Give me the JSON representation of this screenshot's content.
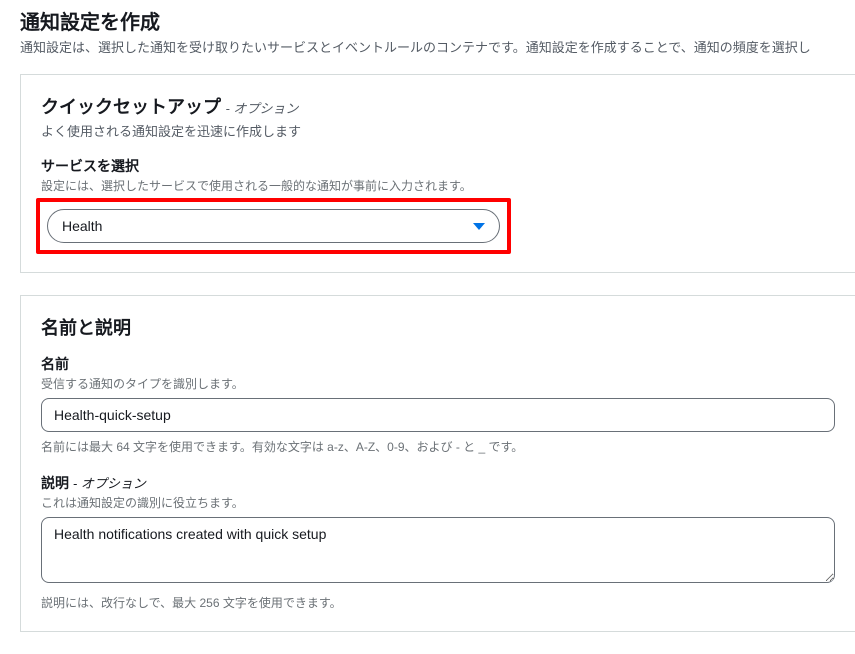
{
  "page": {
    "title": "通知設定を作成",
    "description": "通知設定は、選択した通知を受け取りたいサービスとイベントルールのコンテナです。通知設定を作成することで、通知の頻度を選択し"
  },
  "quickSetup": {
    "heading": "クイックセットアップ",
    "optional": "- オプション",
    "sub": "よく使用される通知設定を迅速に作成します",
    "serviceLabel": "サービスを選択",
    "serviceHint": "設定には、選択したサービスで使用される一般的な通知が事前に入力されます。",
    "serviceValue": "Health"
  },
  "nameDesc": {
    "heading": "名前と説明",
    "nameLabel": "名前",
    "nameHint": "受信する通知のタイプを識別します。",
    "nameValue": "Health-quick-setup",
    "nameConstraint": "名前には最大 64 文字を使用できます。有効な文字は a-z、A-Z、0-9、および - と _ です。",
    "descLabel": "説明",
    "descOptional": "- オプション",
    "descHint": "これは通知設定の識別に役立ちます。",
    "descValue": "Health notifications created with quick setup",
    "descConstraint": "説明には、改行なしで、最大 256 文字を使用できます。"
  }
}
